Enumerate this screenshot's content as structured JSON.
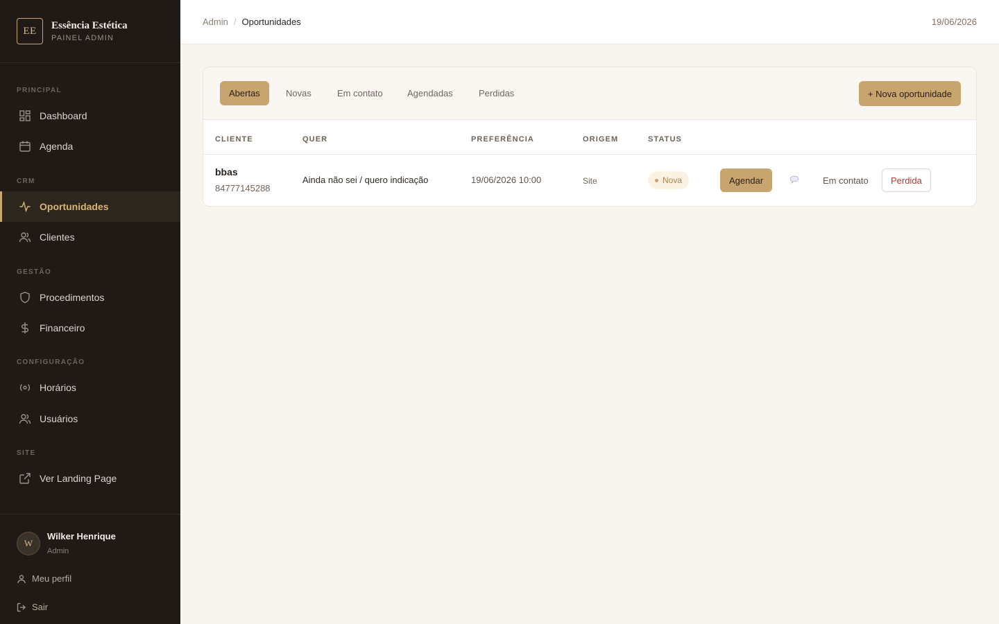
{
  "brand": {
    "logo": "EE",
    "name": "Essência Estética",
    "subtitle": "PAINEL ADMIN"
  },
  "sidebar": {
    "sections": [
      {
        "label": "PRINCIPAL"
      },
      {
        "label": "CRM"
      },
      {
        "label": "GESTÃO"
      },
      {
        "label": "CONFIGURAÇÃO"
      },
      {
        "label": "SITE"
      }
    ],
    "items": [
      {
        "label": "Dashboard",
        "icon": "dashboard-icon"
      },
      {
        "label": "Agenda",
        "icon": "calendar-icon"
      },
      {
        "label": "Oportunidades",
        "icon": "activity-icon",
        "active": true
      },
      {
        "label": "Clientes",
        "icon": "users-icon"
      },
      {
        "label": "Procedimentos",
        "icon": "shield-icon"
      },
      {
        "label": "Financeiro",
        "icon": "dollar-icon"
      },
      {
        "label": "Horários",
        "icon": "radio-icon"
      },
      {
        "label": "Usuários",
        "icon": "users-icon"
      },
      {
        "label": "Ver Landing Page",
        "icon": "external-link-icon"
      }
    ]
  },
  "user": {
    "initial": "W",
    "name": "Wilker Henrique",
    "role": "Admin",
    "profile_label": "Meu perfil",
    "logout_label": "Sair"
  },
  "header": {
    "breadcrumb_root": "Admin",
    "breadcrumb_sep": "/",
    "breadcrumb_current": "Oportunidades",
    "date": "19/06/2026"
  },
  "tabs": [
    {
      "label": "Abertas",
      "active": true
    },
    {
      "label": "Novas"
    },
    {
      "label": "Em contato"
    },
    {
      "label": "Agendadas"
    },
    {
      "label": "Perdidas"
    }
  ],
  "new_button": "+ Nova oportunidade",
  "table": {
    "columns": [
      "CLIENTE",
      "QUER",
      "PREFERÊNCIA",
      "ORIGEM",
      "STATUS"
    ],
    "rows": [
      {
        "client": "bbas",
        "phone": "84777145288",
        "wants": "Ainda não sei / quero indicação",
        "preference": "19/06/2026 10:00",
        "origin": "Site",
        "status": "Nova",
        "actions": {
          "schedule": "Agendar",
          "contact": "Em contato",
          "lost": "Perdida"
        }
      }
    ]
  },
  "colors": {
    "sidebar_bg": "#1f1a16",
    "accent": "#c8a56f",
    "page_bg": "#f8f5f0",
    "danger": "#b33a2d"
  }
}
